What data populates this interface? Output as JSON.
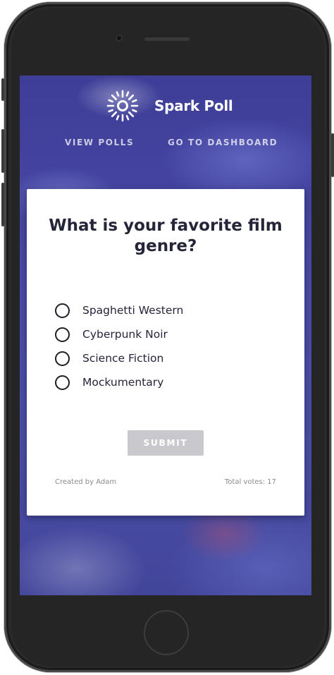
{
  "app": {
    "brand": "Spark Poll",
    "logo_icon": "sun-burst-icon"
  },
  "nav": {
    "items": [
      {
        "label": "VIEW POLLS"
      },
      {
        "label": "GO TO DASHBOARD"
      }
    ]
  },
  "poll": {
    "question": "What is your favorite film genre?",
    "options": [
      {
        "label": "Spaghetti Western",
        "selected": false
      },
      {
        "label": "Cyberpunk Noir",
        "selected": false
      },
      {
        "label": "Science Fiction",
        "selected": false
      },
      {
        "label": "Mockumentary",
        "selected": false
      }
    ],
    "submit_label": "SUBMIT",
    "created_by": "Created by Adam",
    "total_votes": "Total votes: 17"
  },
  "colors": {
    "header_bg": "#3f3f9a",
    "submit_disabled": "#c8c8cd",
    "text_dark": "#25253a"
  }
}
